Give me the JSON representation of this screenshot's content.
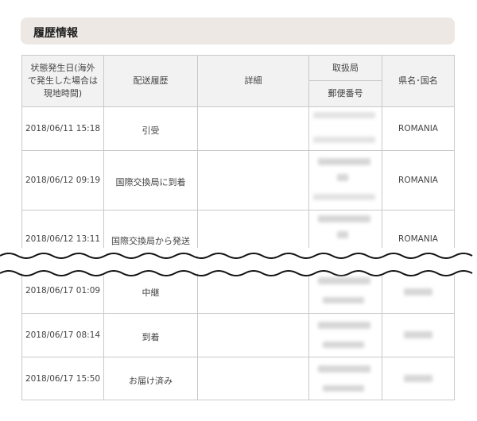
{
  "section": {
    "title": "履歴情報"
  },
  "table": {
    "headers": {
      "date": "状態発生日(海外で発生した場合は現地時間)",
      "date_lines": [
        "状態発生日(海外",
        "で発生した場合は",
        "現地時間)"
      ],
      "status": "配送履歴",
      "detail": "詳細",
      "office": "取扱局",
      "postal_code": "郵便番号",
      "region": "県名･国名"
    },
    "rows": [
      {
        "date": "2018/06/11 15:18",
        "status": "引受",
        "region": "ROMANIA"
      },
      {
        "date": "2018/06/12 09:19",
        "status": "国際交換局に到着",
        "region": "ROMANIA"
      },
      {
        "date": "2018/06/12 13:11",
        "status": "国際交換局から発送",
        "region": "ROMANIA"
      },
      {
        "date": "2018/06/17 01:09",
        "status": "中継",
        "region": ""
      },
      {
        "date": "2018/06/17 08:14",
        "status": "到着",
        "region": ""
      },
      {
        "date": "2018/06/17 15:50",
        "status": "お届け済み",
        "region": ""
      }
    ]
  }
}
